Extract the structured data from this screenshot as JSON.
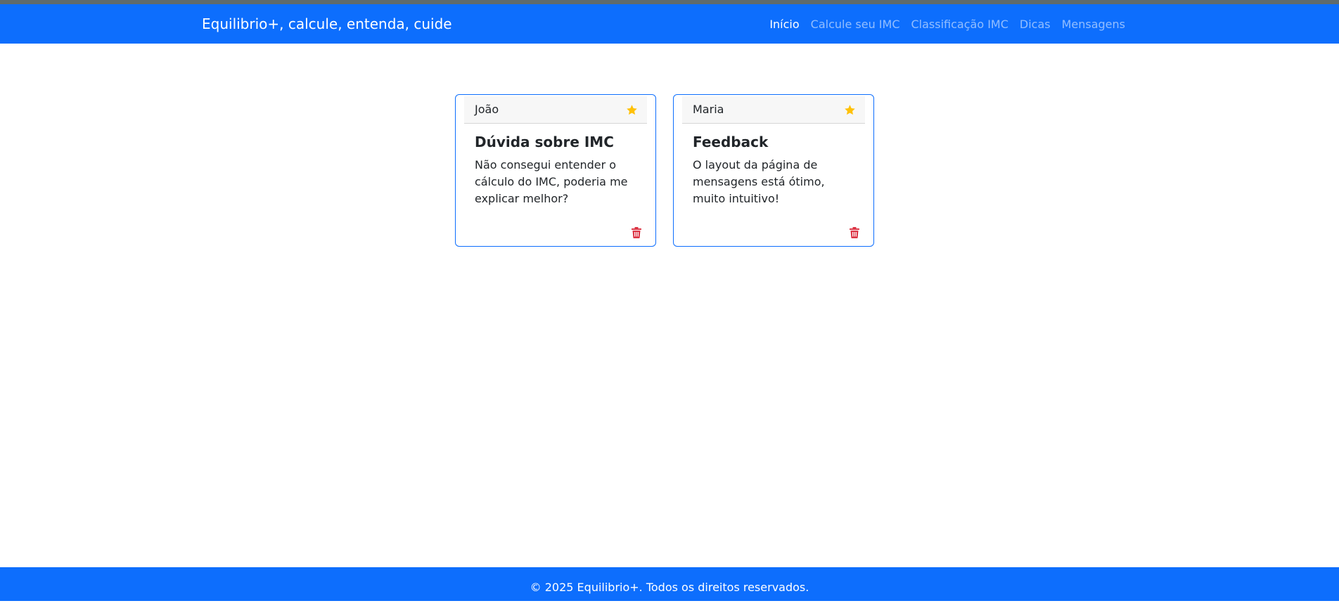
{
  "navbar": {
    "brand": "Equilibrio+, calcule, entenda, cuide",
    "links": [
      {
        "label": "Início",
        "active": true
      },
      {
        "label": "Calcule seu IMC",
        "active": false
      },
      {
        "label": "Classificação IMC",
        "active": false
      },
      {
        "label": "Dicas",
        "active": false
      },
      {
        "label": "Mensagens",
        "active": false
      }
    ]
  },
  "messages": [
    {
      "author": "João",
      "title": "Dúvida sobre IMC",
      "text": "Não consegui entender o cálculo do IMC, poderia me explicar melhor?",
      "favorite_icon": "star-icon",
      "delete_icon": "trash-icon"
    },
    {
      "author": "Maria",
      "title": "Feedback",
      "text": "O layout da página de mensagens está ótimo, muito intuitivo!",
      "favorite_icon": "star-icon",
      "delete_icon": "trash-icon"
    }
  ],
  "footer": {
    "text": "© 2025 Equilibrio+. Todos os direitos reservados."
  },
  "colors": {
    "primary": "#0d6efd",
    "star": "#ffc107",
    "delete": "#dc3545",
    "top_strip": "#5f6b6d"
  }
}
